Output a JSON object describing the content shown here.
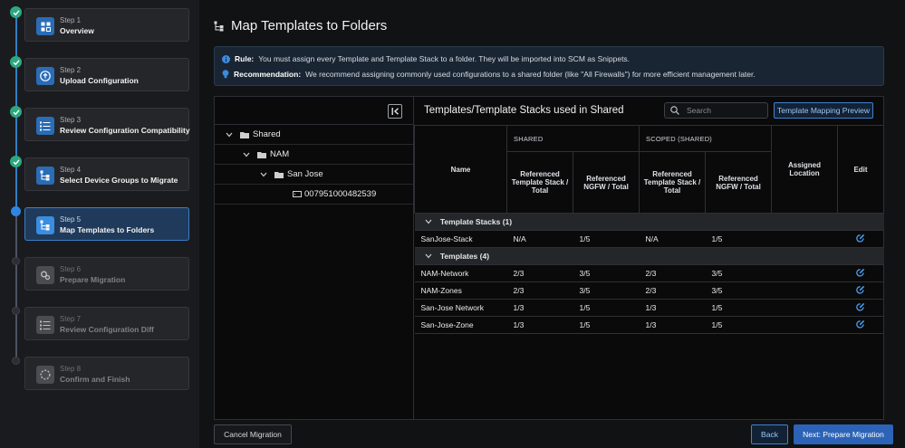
{
  "steps": [
    {
      "num": "Step 1",
      "title": "Overview",
      "state": "done"
    },
    {
      "num": "Step 2",
      "title": "Upload Configuration",
      "state": "done"
    },
    {
      "num": "Step 3",
      "title": "Review Configuration Compatibility",
      "state": "done"
    },
    {
      "num": "Step 4",
      "title": "Select Device Groups to Migrate",
      "state": "done"
    },
    {
      "num": "Step 5",
      "title": "Map Templates to Folders",
      "state": "current"
    },
    {
      "num": "Step 6",
      "title": "Prepare Migration",
      "state": "todo"
    },
    {
      "num": "Step 7",
      "title": "Review Configuration Diff",
      "state": "todo"
    },
    {
      "num": "Step 8",
      "title": "Confirm and Finish",
      "state": "todo"
    }
  ],
  "page": {
    "title": "Map Templates to Folders"
  },
  "info": {
    "rule_label": "Rule:",
    "rule_text": "You must assign every Template and Template Stack to a folder. They will be imported into SCM as Snippets.",
    "rec_label": "Recommendation:",
    "rec_text": "We recommend assigning commonly used configurations to a shared folder (like \"All Firewalls\") for more efficient management later."
  },
  "tree": {
    "items": [
      {
        "label": "Shared"
      },
      {
        "label": "NAM"
      },
      {
        "label": "San Jose"
      },
      {
        "label": "007951000482539"
      }
    ]
  },
  "grid": {
    "title": "Templates/Template Stacks used in Shared",
    "search_placeholder": "Search",
    "preview_button": "Template Mapping Preview",
    "headers": {
      "name": "Name",
      "shared": "SHARED",
      "scoped": "SCOPED (SHARED)",
      "ref_template": "Referenced Template Stack / Total",
      "ref_ngfw": "Referenced NGFW / Total",
      "assigned": "Assigned Location",
      "edit": "Edit"
    },
    "sections": [
      {
        "label": "Template Stacks (1)",
        "rows": [
          {
            "name": "SanJose-Stack",
            "shared_tpl": "N/A",
            "shared_ngfw": "1/5",
            "scoped_tpl": "N/A",
            "scoped_ngfw": "1/5"
          }
        ]
      },
      {
        "label": "Templates (4)",
        "rows": [
          {
            "name": "NAM-Network",
            "shared_tpl": "2/3",
            "shared_ngfw": "3/5",
            "scoped_tpl": "2/3",
            "scoped_ngfw": "3/5"
          },
          {
            "name": "NAM-Zones",
            "shared_tpl": "2/3",
            "shared_ngfw": "3/5",
            "scoped_tpl": "2/3",
            "scoped_ngfw": "3/5"
          },
          {
            "name": "San-Jose Network",
            "shared_tpl": "1/3",
            "shared_ngfw": "1/5",
            "scoped_tpl": "1/3",
            "scoped_ngfw": "1/5"
          },
          {
            "name": "San-Jose-Zone",
            "shared_tpl": "1/3",
            "shared_ngfw": "1/5",
            "scoped_tpl": "1/3",
            "scoped_ngfw": "1/5"
          }
        ]
      }
    ]
  },
  "footer": {
    "cancel": "Cancel Migration",
    "back": "Back",
    "next": "Next: Prepare Migration"
  },
  "colors": {
    "accent": "#2c63b7",
    "success": "#2ca87f",
    "edit_icon": "#4a9ef0"
  }
}
